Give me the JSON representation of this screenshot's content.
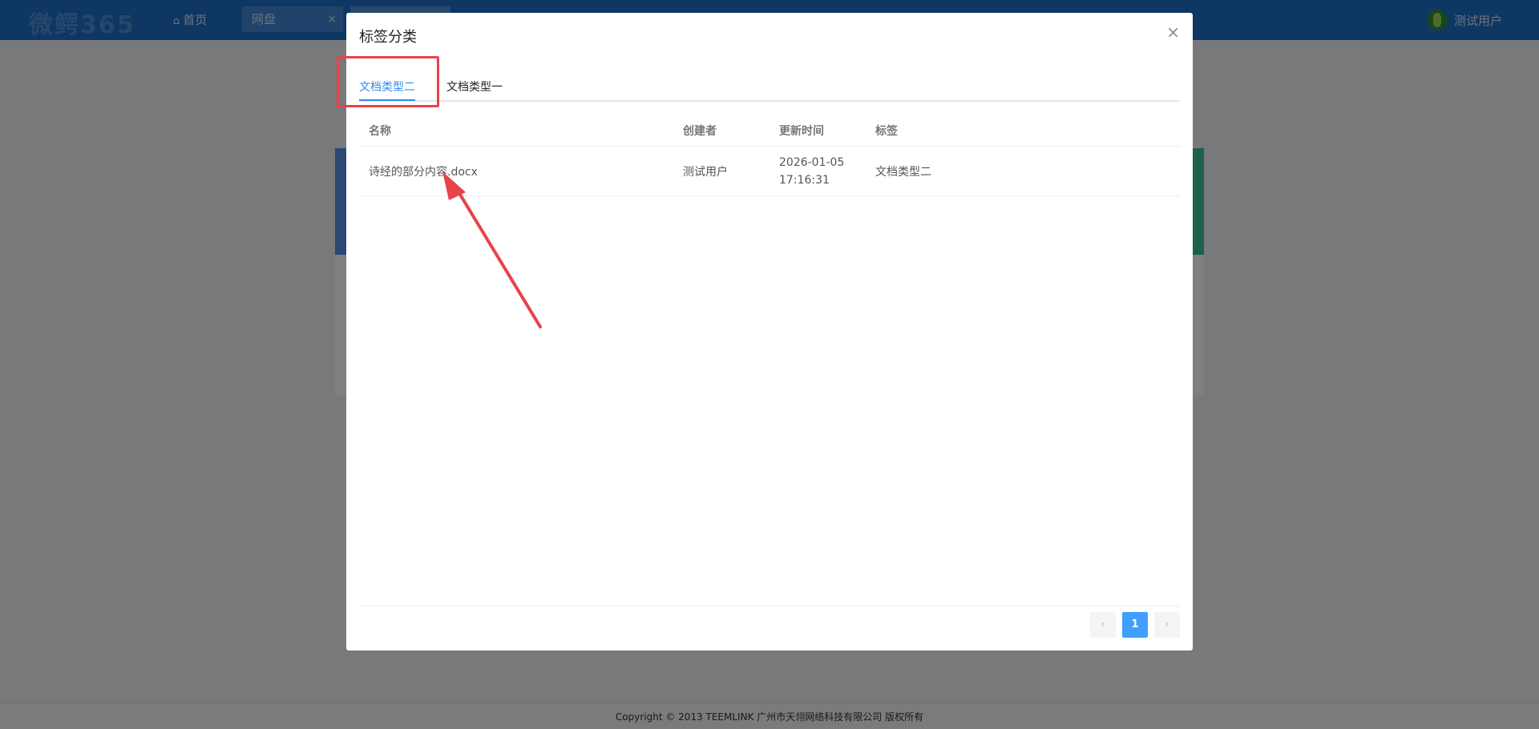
{
  "app": {
    "logo": "微鳄365"
  },
  "nav": {
    "home_icon": "home-icon",
    "home_label": "首页",
    "tabs": [
      {
        "label": "网盘",
        "close": "×"
      },
      {
        "label": "",
        "close": ""
      }
    ]
  },
  "user": {
    "name": "测试用户",
    "avatar_icon": "avatar-icon"
  },
  "modal": {
    "title": "标签分类",
    "close": "×",
    "tabs": [
      {
        "label": "文档类型二",
        "active": true
      },
      {
        "label": "文档类型一",
        "active": false
      }
    ],
    "table": {
      "headers": [
        "名称",
        "创建者",
        "更新时间",
        "标签"
      ],
      "rows": [
        {
          "name": "诗经的部分内容.docx",
          "creator": "测试用户",
          "date": "2026-01-05",
          "time": "17:16:31",
          "tag": "文档类型二"
        }
      ]
    },
    "pagination": {
      "prev": "‹",
      "current": "1",
      "next": "›"
    }
  },
  "footer": {
    "text": "Copyright © 2013 TEEMLINK 广州市天翎网络科技有限公司 版权所有"
  },
  "colors": {
    "accent": "#409eff",
    "annotation": "#e8434a",
    "topbar": "#1e6fc9"
  }
}
